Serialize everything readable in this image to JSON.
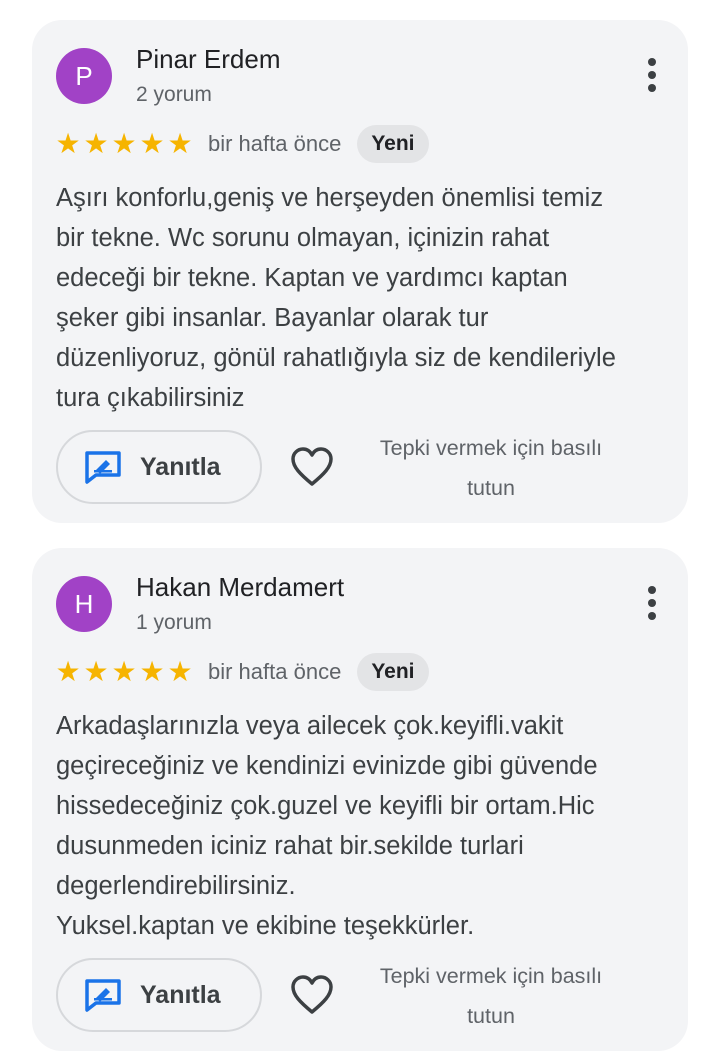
{
  "reviews": [
    {
      "avatar_letter": "P",
      "avatar_color": "#a142c6",
      "name": "Pinar Erdem",
      "review_count": "2 yorum",
      "rating": 5,
      "time": "bir hafta önce",
      "badge": "Yeni",
      "text": "Aşırı konforlu,geniş ve herşeyden önemlisi temiz\nbir tekne. Wc sorunu olmayan, içinizin rahat\nedeceği bir tekne. Kaptan ve yardımcı kaptan\nşeker gibi insanlar. Bayanlar olarak tur\ndüzenliyoruz, gönül rahatlığıyla siz de kendileriyle\ntura çıkabilirsiniz",
      "reply_label": "Yanıtla",
      "react_hint": "Tepki vermek için basılı\ntutun"
    },
    {
      "avatar_letter": "H",
      "avatar_color": "#a142c6",
      "name": "Hakan Merdamert",
      "review_count": "1 yorum",
      "rating": 5,
      "time": "bir hafta önce",
      "badge": "Yeni",
      "text": "Arkadaşlarınızla veya ailecek çok.keyifli.vakit\ngeçireceğiniz ve kendinizi evinizde gibi güvende\nhissedeceğiniz çok.guzel ve keyifli bir ortam.Hic\ndusunmeden iciniz rahat bir.sekilde turlari\ndegerlendirebilirsiniz.\nYuksel.kaptan ve ekibine teşekkürler.",
      "reply_label": "Yanıtla",
      "react_hint": "Tepki vermek için basılı\ntutun"
    }
  ],
  "colors": {
    "star": "#f6b400",
    "reply_icon": "#1a73e8"
  },
  "icons": [
    "more-vert-icon",
    "star-icon",
    "reply-icon",
    "heart-icon"
  ]
}
